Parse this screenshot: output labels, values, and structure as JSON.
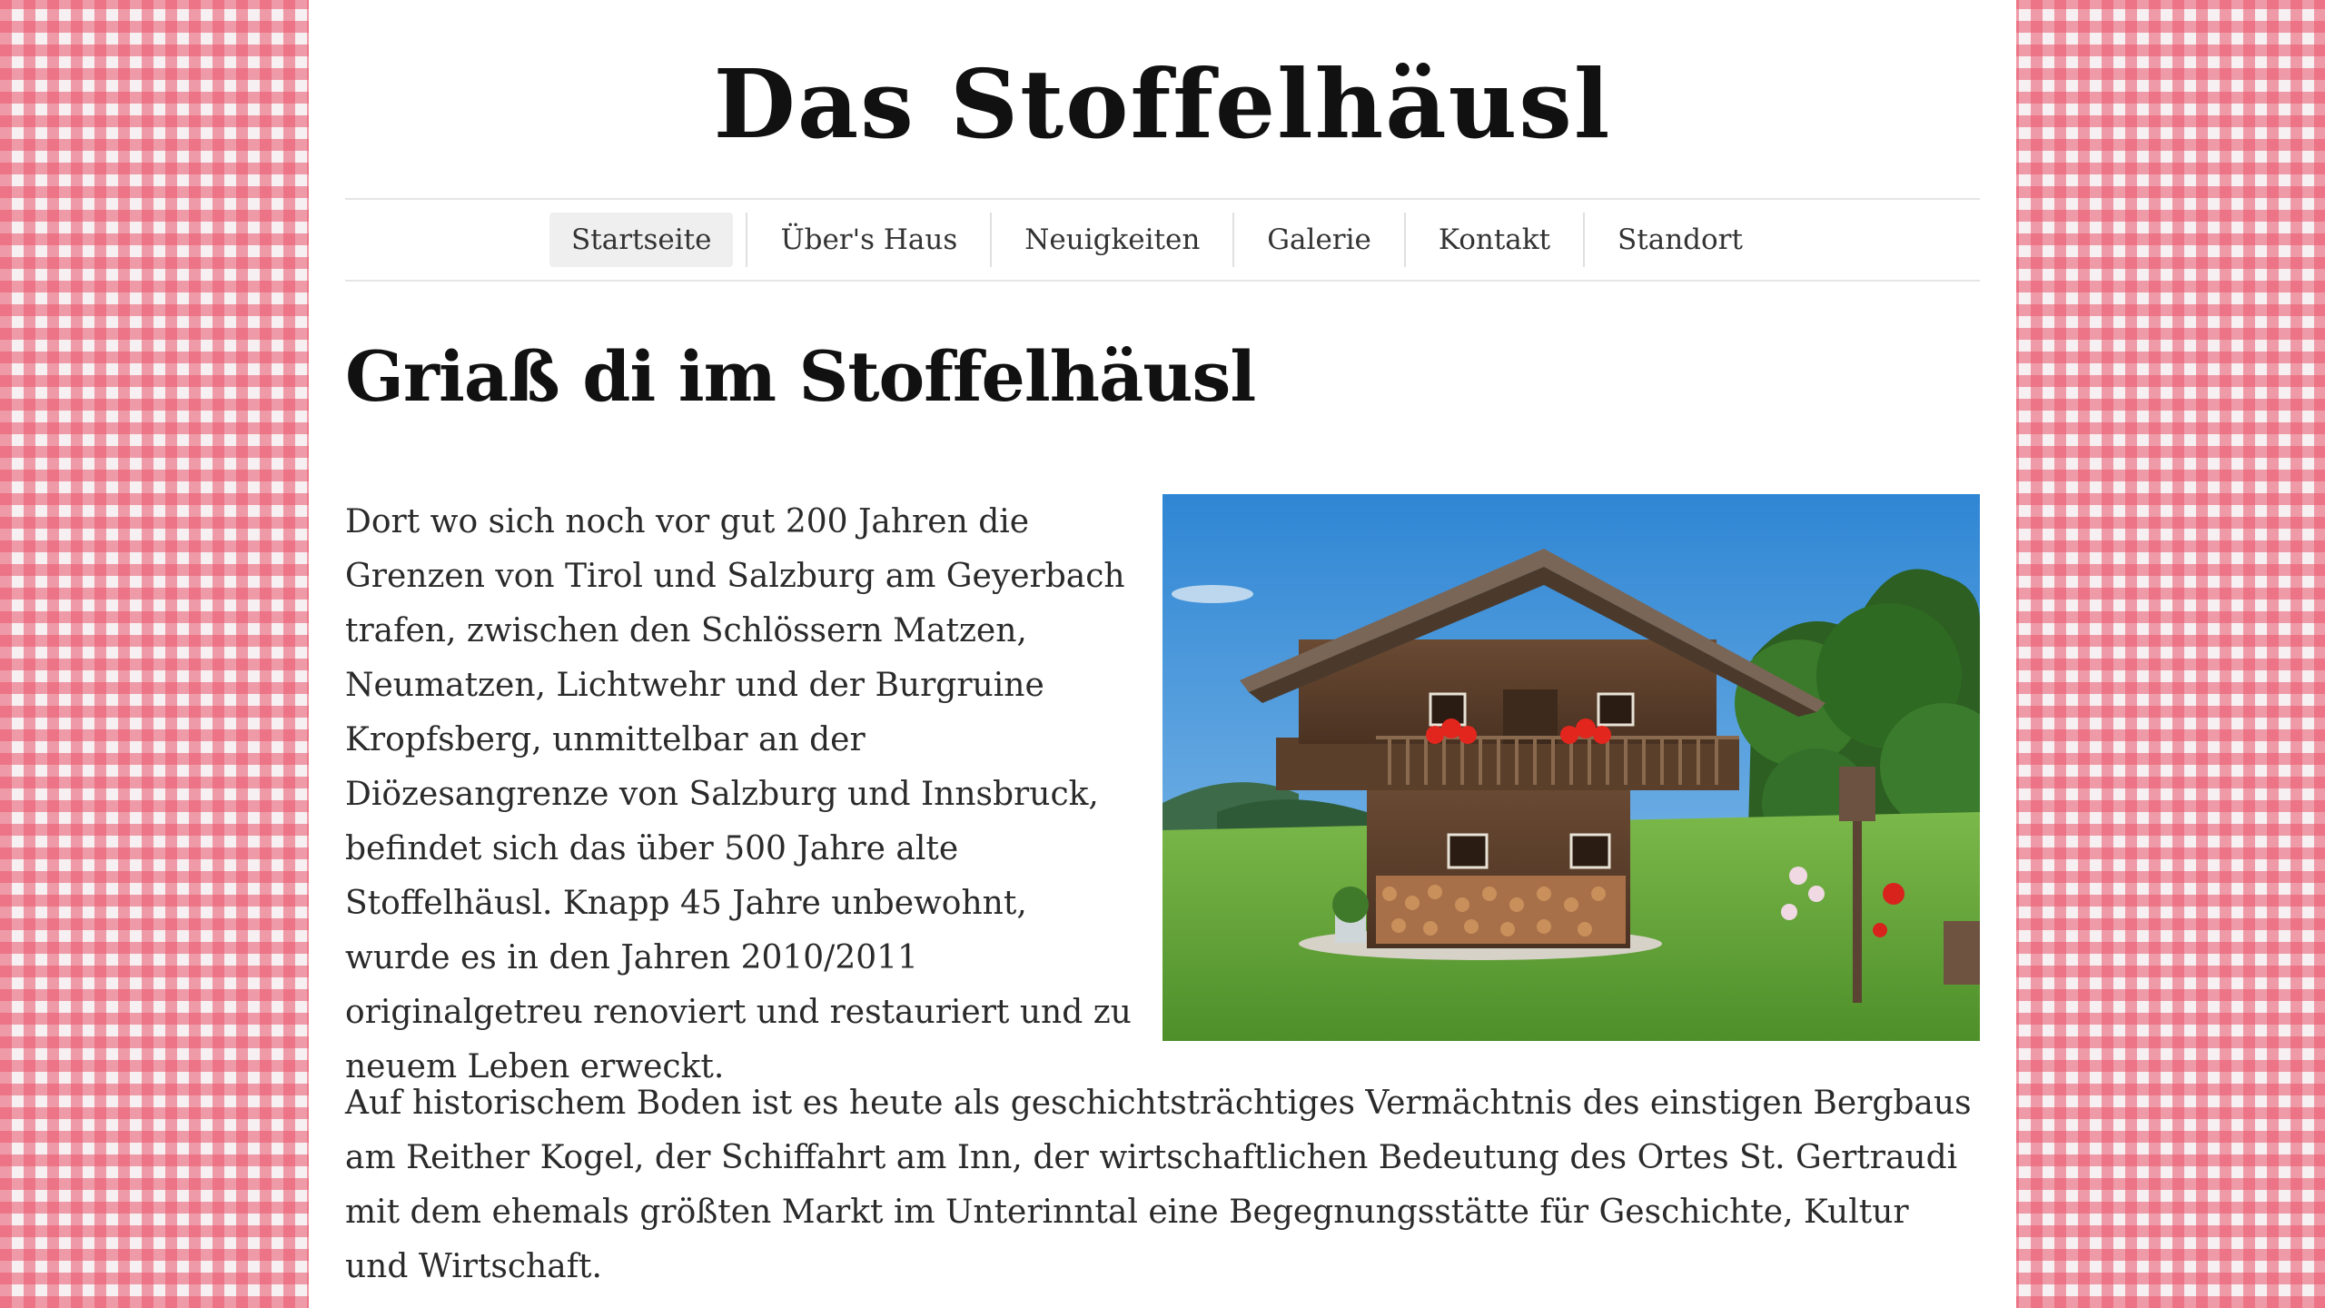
{
  "site": {
    "title": "Das Stoffelhäusl"
  },
  "nav": {
    "items": [
      {
        "label": "Startseite"
      },
      {
        "label": "Über's Haus"
      },
      {
        "label": "Neuigkeiten"
      },
      {
        "label": "Galerie"
      },
      {
        "label": "Kontakt"
      },
      {
        "label": "Standort"
      }
    ],
    "active_index": 0
  },
  "main": {
    "heading": "Griaß di im Stoffelhäusl",
    "paragraph1": "Dort wo sich noch vor gut 200 Jahren die Grenzen von Tirol und Salzburg am Geyerbach trafen, zwischen den Schlössern Matzen, Neumatzen, Lichtwehr und der Burgruine Kropfsberg, unmittelbar an der Diözesangrenze von Salzburg und Innsbruck, befindet sich das über 500 Jahre alte Stoffelhäusl. Knapp 45 Jahre unbewohnt, wurde es in den Jahren 2010/2011 originalgetreu renoviert und restauriert und zu neuem Leben erweckt.",
    "paragraph2": "Auf historischem Boden ist es heute als geschichtsträchtiges Vermächtnis des einstigen Bergbaus am Reither Kogel, der Schiffahrt am Inn, der wirtschaftlichen Bedeutung des Ortes St. Gertraudi mit dem ehemals größten Markt im Unterinntal eine Begegnungsstätte für Geschichte, Kultur und Wirtschaft."
  },
  "colors": {
    "gingham": "#e9546a",
    "page_background": "#ffffff",
    "text": "#2a2a2a"
  }
}
